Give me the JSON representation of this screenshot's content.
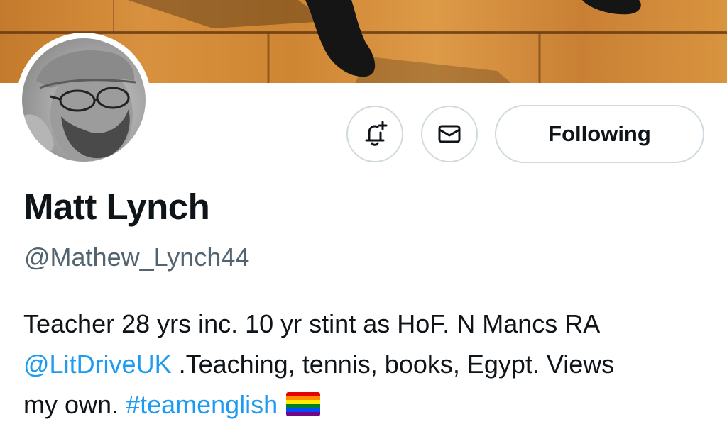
{
  "profile": {
    "display_name": "Matt Lynch",
    "handle": "@Mathew_Lynch44",
    "bio": {
      "line1": "Teacher 28 yrs inc. 10 yr stint as HoF. N Mancs RA",
      "mention": "@LitDriveUK",
      "line2_rest": " .Teaching, tennis, books, Egypt. Views",
      "line3_start": "my own. ",
      "hashtag": "#teamenglish",
      "flag_icon": "rainbow-flag-icon"
    }
  },
  "actions": {
    "notify_icon": "bell-plus-icon",
    "message_icon": "envelope-icon",
    "follow_label": "Following"
  },
  "colors": {
    "text_primary": "#0f1419",
    "text_secondary": "#536471",
    "link": "#1d9bf0",
    "button_border": "#cfd9de"
  }
}
